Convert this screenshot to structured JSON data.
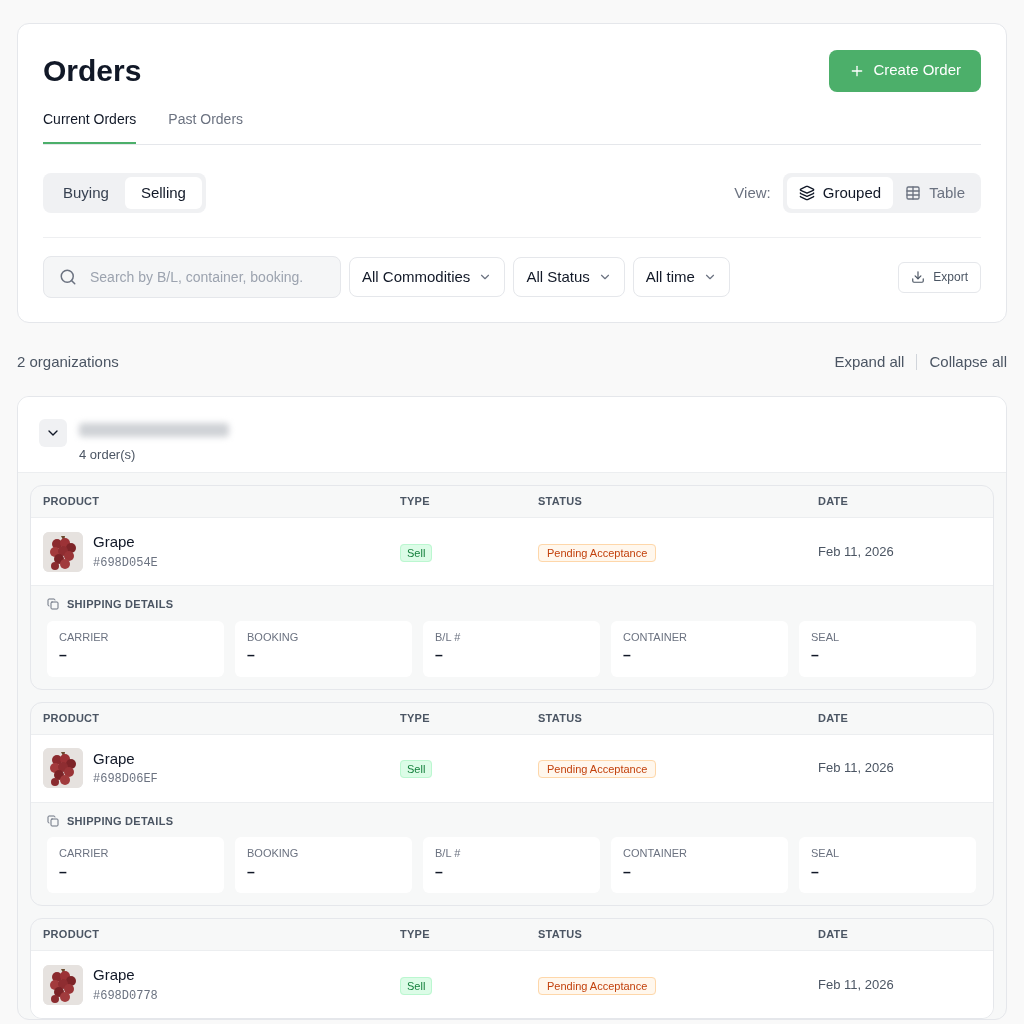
{
  "page": {
    "title": "Orders",
    "create_button": "Create Order"
  },
  "tabs": [
    {
      "label": "Current Orders",
      "selected": true
    },
    {
      "label": "Past Orders",
      "selected": false
    }
  ],
  "side_toggle": [
    {
      "label": "Buying",
      "selected": false
    },
    {
      "label": "Selling",
      "selected": true
    }
  ],
  "view": {
    "label": "View:",
    "options": [
      {
        "label": "Grouped",
        "selected": true
      },
      {
        "label": "Table",
        "selected": false
      }
    ]
  },
  "filters": {
    "search_placeholder": "Search by B/L, container, booking.",
    "dropdowns": [
      "All Commodities",
      "All Status",
      "All time"
    ],
    "export": "Export"
  },
  "summary": {
    "count": "2 organizations",
    "expand_all": "Expand all",
    "collapse_all": "Collapse all"
  },
  "organizations": [
    {
      "expanded": true,
      "order_count": "4 order(s)",
      "orders": [
        {
          "columns": [
            "PRODUCT",
            "TYPE",
            "STATUS",
            "DATE"
          ],
          "product": "Grape",
          "id": "#698D054E",
          "type": "Sell",
          "status": "Pending Acceptance",
          "date": "Feb 11, 2026",
          "shipping_title": "SHIPPING DETAILS",
          "shipping": [
            {
              "label": "CARRIER",
              "value": "–"
            },
            {
              "label": "BOOKING",
              "value": "–"
            },
            {
              "label": "B/L #",
              "value": "–"
            },
            {
              "label": "CONTAINER",
              "value": "–"
            },
            {
              "label": "SEAL",
              "value": "–"
            }
          ]
        },
        {
          "columns": [
            "PRODUCT",
            "TYPE",
            "STATUS",
            "DATE"
          ],
          "product": "Grape",
          "id": "#698D06EF",
          "type": "Sell",
          "status": "Pending Acceptance",
          "date": "Feb 11, 2026",
          "shipping_title": "SHIPPING DETAILS",
          "shipping": [
            {
              "label": "CARRIER",
              "value": "–"
            },
            {
              "label": "BOOKING",
              "value": "–"
            },
            {
              "label": "B/L #",
              "value": "–"
            },
            {
              "label": "CONTAINER",
              "value": "–"
            },
            {
              "label": "SEAL",
              "value": "–"
            }
          ]
        },
        {
          "columns": [
            "PRODUCT",
            "TYPE",
            "STATUS",
            "DATE"
          ],
          "product": "Grape",
          "id": "#698D0778",
          "type": "Sell",
          "status": "Pending Acceptance",
          "date": "Feb 11, 2026"
        }
      ]
    }
  ]
}
